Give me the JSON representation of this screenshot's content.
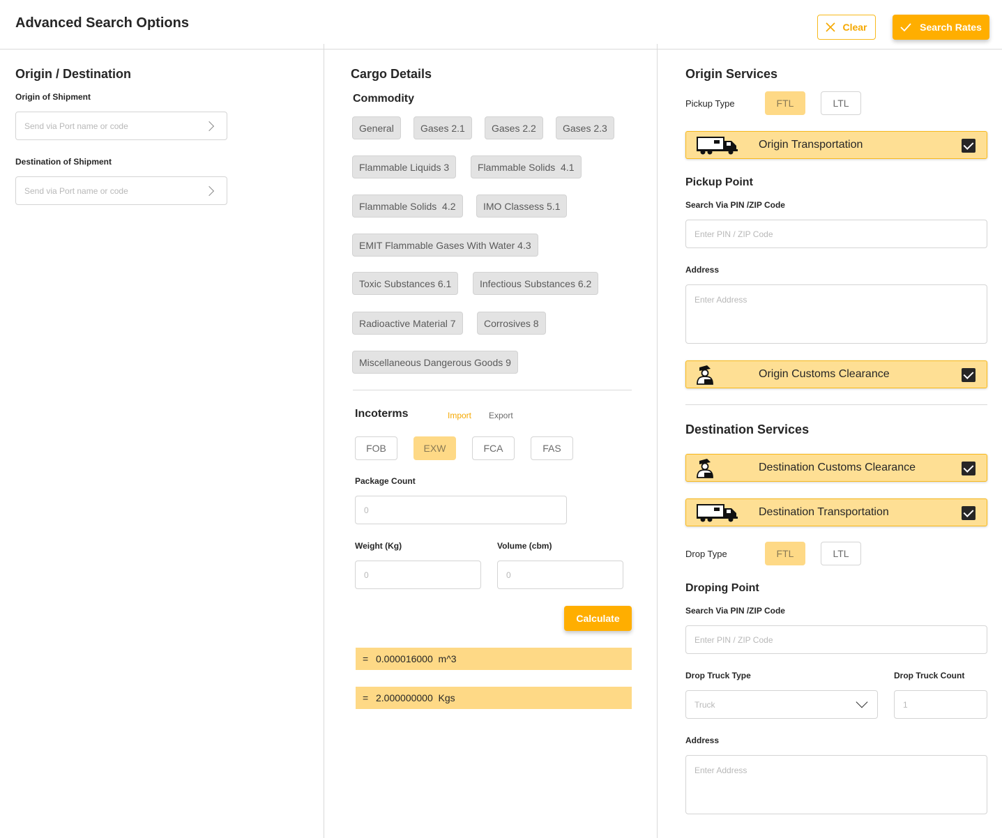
{
  "header": {
    "title": "Advanced Search Options",
    "clear_label": "Clear",
    "search_label": "Search Rates"
  },
  "origin_destination": {
    "title": "Origin / Destination",
    "origin_label": "Origin of Shipment",
    "origin_placeholder": "Send via  Port name or code",
    "destination_label": "Destination of Shipment",
    "destination_placeholder": "Send via  Port name or code"
  },
  "cargo": {
    "title": "Cargo Details",
    "commodity_title": "Commodity",
    "commodities": [
      "General",
      "Gases 2.1",
      "Gases 2.2",
      "Gases 2.3",
      "Flammable Liquids 3",
      "Flammable Solids  4.1",
      "Flammable Solids  4.2",
      "IMO Classess 5.1",
      "EMIT Flammable Gases With Water 4.3",
      "Toxic Substances 6.1",
      "Infectious Substances 6.2",
      "Radioactive Material 7",
      "Corrosives 8",
      "Miscellaneous Dangerous Goods 9"
    ],
    "incoterms_title": "Incoterms",
    "import_label": "Import",
    "export_label": "Export",
    "incoterms": [
      "FOB",
      "EXW",
      "FCA",
      "FAS"
    ],
    "selected_incoterm": "EXW",
    "package_count_label": "Package Count",
    "package_count_placeholder": "0",
    "weight_label": "Weight (Kg)",
    "weight_placeholder": "0",
    "volume_label": "Volume (cbm)",
    "volume_placeholder": "0",
    "calculate_label": "Calculate",
    "results": [
      {
        "eq": "=",
        "value": "0.000016000  m^3"
      },
      {
        "eq": "=",
        "value": "2.000000000  Kgs"
      }
    ]
  },
  "origin_services": {
    "title": "Origin Services",
    "pickup_type_label": "Pickup Type",
    "ftl_label": "FTL",
    "ltl_label": "LTL",
    "selected_pickup": "FTL",
    "transport_label": "Origin Transportation",
    "transport_checked": true,
    "pickup_point_title": "Pickup Point",
    "pin_label": "Search Via PIN /ZIP Code",
    "pin_placeholder": "Enter PIN / ZIP Code",
    "address_label": "Address",
    "address_placeholder": "Enter Address",
    "customs_label": "Origin Customs Clearance",
    "customs_checked": true
  },
  "destination_services": {
    "title": "Destination Services",
    "customs_label": "Destination Customs Clearance",
    "customs_checked": true,
    "transport_label": "Destination Transportation",
    "transport_checked": true,
    "drop_type_label": "Drop Type",
    "ftl_label": "FTL",
    "ltl_label": "LTL",
    "selected_drop": "FTL",
    "droping_point_title": "Droping Point",
    "pin_label": "Search Via PIN /ZIP Code",
    "pin_placeholder": "Enter PIN / ZIP Code",
    "truck_type_label": "Drop Truck Type",
    "truck_type_value": "Truck",
    "truck_count_label": "Drop Truck Count",
    "truck_count_placeholder": "1",
    "address_label": "Address",
    "address_placeholder": "Enter Address"
  },
  "colors": {
    "accent": "#ffae00",
    "accent_light": "#fedf94",
    "chip_bg": "#e3e3e3"
  },
  "icons": [
    "close-icon",
    "check-icon",
    "chevron-right-icon",
    "truck-icon",
    "customs-officer-icon",
    "chevron-down-icon"
  ]
}
